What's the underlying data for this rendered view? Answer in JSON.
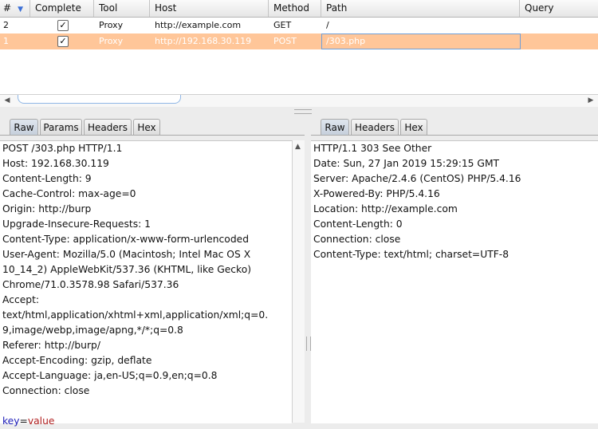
{
  "table": {
    "columns": [
      "#",
      "Complete",
      "Tool",
      "Host",
      "Method",
      "Path",
      "Query"
    ],
    "rows": [
      {
        "num": "2",
        "complete": true,
        "tool": "Proxy",
        "host": "http://example.com",
        "method": "GET",
        "path": "/",
        "query": ""
      },
      {
        "num": "1",
        "complete": true,
        "tool": "Proxy",
        "host": "http://192.168.30.119",
        "method": "POST",
        "path": "/303.php",
        "query": ""
      }
    ],
    "check_glyph": "✓",
    "sort_icon": "▼"
  },
  "request": {
    "tabs": [
      "Raw",
      "Params",
      "Headers",
      "Hex"
    ],
    "active_tab": "Raw",
    "lines": [
      "POST /303.php HTTP/1.1",
      "Host: 192.168.30.119",
      "Content-Length: 9",
      "Cache-Control: max-age=0",
      "Origin: http://burp",
      "Upgrade-Insecure-Requests: 1",
      "Content-Type: application/x-www-form-urlencoded",
      "User-Agent: Mozilla/5.0 (Macintosh; Intel Mac OS X",
      "10_14_2) AppleWebKit/537.36 (KHTML, like Gecko)",
      "Chrome/71.0.3578.98 Safari/537.36",
      "Accept:",
      "text/html,application/xhtml+xml,application/xml;q=0.",
      "9,image/webp,image/apng,*/*;q=0.8",
      "Referer: http://burp/",
      "Accept-Encoding: gzip, deflate",
      "Accept-Language: ja,en-US;q=0.9,en;q=0.8",
      "Connection: close",
      ""
    ],
    "body": {
      "key": "key",
      "eq": "=",
      "value": "value"
    }
  },
  "response": {
    "tabs": [
      "Raw",
      "Headers",
      "Hex"
    ],
    "active_tab": "Raw",
    "lines": [
      "HTTP/1.1 303 See Other",
      "Date: Sun, 27 Jan 2019 15:29:15 GMT",
      "Server: Apache/2.4.6 (CentOS) PHP/5.4.16",
      "X-Powered-By: PHP/5.4.16",
      "Location: http://example.com",
      "Content-Length: 0",
      "Connection: close",
      "Content-Type: text/html; charset=UTF-8"
    ]
  },
  "icons": {
    "left_arrow": "◀",
    "right_arrow": "▶",
    "up_arrow": "▲"
  }
}
